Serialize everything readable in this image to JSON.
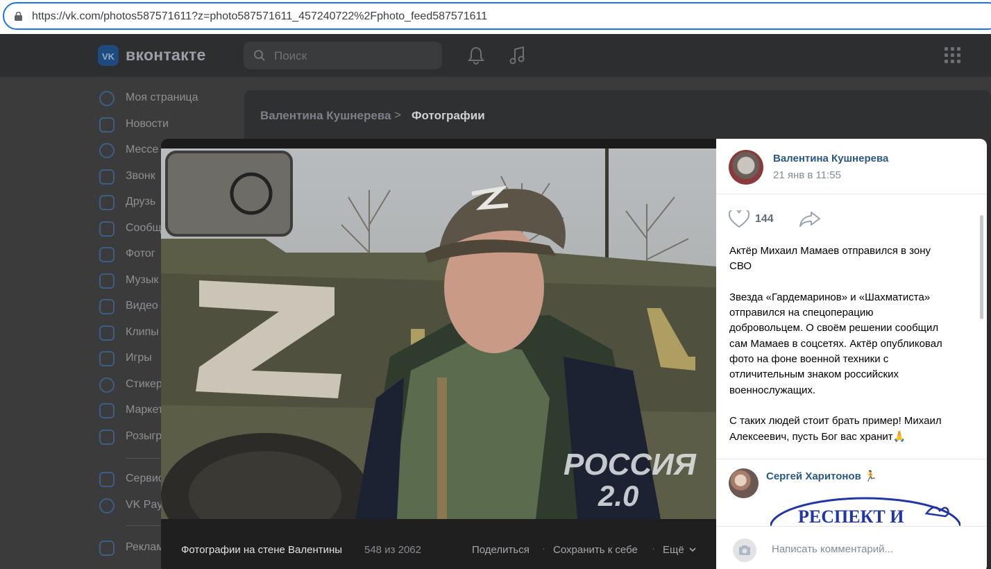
{
  "browser": {
    "url": "https://vk.com/photos587571611?z=photo587571611_457240722%2Fphoto_feed587571611"
  },
  "header": {
    "logo_text": "вконтакте",
    "search_placeholder": "Поиск"
  },
  "sidebar": {
    "items": [
      {
        "label": "Моя страница",
        "icon": "user-circle-icon"
      },
      {
        "label": "Новости",
        "icon": "news-icon"
      },
      {
        "label": "Мессе",
        "icon": "message-icon"
      },
      {
        "label": "Звонк",
        "icon": "phone-icon"
      },
      {
        "label": "Друзь",
        "icon": "friends-icon"
      },
      {
        "label": "Сообщ",
        "icon": "communities-icon"
      },
      {
        "label": "Фотог",
        "icon": "photo-icon"
      },
      {
        "label": "Музык",
        "icon": "music-icon"
      },
      {
        "label": "Видео",
        "icon": "video-icon"
      },
      {
        "label": "Клипы",
        "icon": "clips-icon"
      },
      {
        "label": "Игры",
        "icon": "games-icon"
      },
      {
        "label": "Стикер",
        "icon": "sticker-icon"
      },
      {
        "label": "Маркет",
        "icon": "market-icon"
      },
      {
        "label": "Розыгр",
        "icon": "gift-icon"
      },
      {
        "label": "Сервис",
        "icon": "services-icon"
      },
      {
        "label": "VK Pay",
        "icon": "vkpay-icon"
      },
      {
        "label": "Реклам",
        "icon": "ads-icon"
      }
    ]
  },
  "breadcrumb": {
    "parent": "Валентина Кушнерева",
    "separator": ">",
    "current": "Фотографии"
  },
  "photo": {
    "watermark_line1": "РОССИЯ",
    "watermark_line2": "2.0",
    "caption_source": "Фотографии на стене Валентины",
    "counter": "548 из 2062",
    "actions": {
      "share": "Поделиться",
      "save": "Сохранить к себе",
      "more": "Ещё"
    }
  },
  "post": {
    "author": "Валентина Кушнерева",
    "date": "21 янв в 11:55",
    "likes": "144",
    "text": "Актёр Михаил Мамаев отправился в зону\nСВО\n\nЗвезда «Гардемаринов» и «Шахматиста»\nотправился на спецоперацию\nдобровольцем. О своём решении сообщил\nсам Мамаев в соцсетях. Актёр опубликовал\nфото на фоне военной техники с\nотличительным знаком российских\nвоеннослужащих.\n\nС таких людей стоит брать пример! Михаил\nАлексеевич, пусть Бог вас хранит🙏"
  },
  "comment": {
    "author": "Сергей Харитонов 🏃",
    "image_text": "РЕСПЕКТ И"
  },
  "comment_input": {
    "placeholder": "Написать комментарий..."
  }
}
